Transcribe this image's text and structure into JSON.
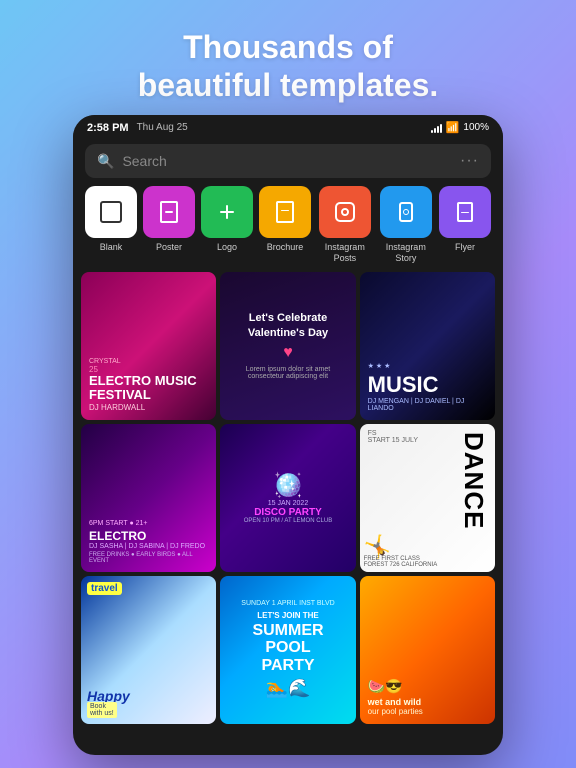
{
  "hero": {
    "line1": "Thousands of",
    "line2": "beautiful templates."
  },
  "statusBar": {
    "time": "2:58 PM",
    "date": "Thu Aug 25",
    "battery": "100%"
  },
  "search": {
    "placeholder": "Search"
  },
  "categories": [
    {
      "id": "blank",
      "label": "Blank",
      "colorClass": "cat-blank",
      "icon": "□"
    },
    {
      "id": "poster",
      "label": "Poster",
      "colorClass": "cat-poster",
      "icon": "🖼"
    },
    {
      "id": "logo",
      "label": "Logo",
      "colorClass": "cat-logo",
      "icon": "+"
    },
    {
      "id": "brochure",
      "label": "Brochure",
      "colorClass": "cat-brochure",
      "icon": "📄"
    },
    {
      "id": "instagram-posts",
      "label": "Instagram Posts",
      "colorClass": "cat-instagram-posts",
      "icon": "📷"
    },
    {
      "id": "instagram-story",
      "label": "Instagram Story",
      "colorClass": "cat-instagram-story",
      "icon": "📱"
    },
    {
      "id": "flyer",
      "label": "Flyer",
      "colorClass": "cat-flyer",
      "icon": "🗒"
    }
  ],
  "templates": [
    {
      "id": "t1",
      "title": "ELECTRO MUSIC FESTIVAL",
      "sub": "DJ HARDWALL",
      "small": "CRYSTAL"
    },
    {
      "id": "t2",
      "title": "Let's Celebrate Valentine's Day",
      "heart": "♥"
    },
    {
      "id": "t3",
      "title": "MUSIC",
      "sub": "DJ MENGAN | DJ DANIEL | DJ LIANDO"
    },
    {
      "id": "t4",
      "title": "ELECTRO",
      "sub": "DJ SASHA | DJ SABINA | DJ FREDO"
    },
    {
      "id": "t5",
      "date": "15 JAN 2022",
      "title": "DISCO PARTY",
      "sub": "OPEN 10 PM / AT LEMON CLUB"
    },
    {
      "id": "t6",
      "title": "DANCE",
      "sub": "FREE FIRST CLASS"
    },
    {
      "id": "t7",
      "title": "Happy",
      "sub": "Book with us!"
    },
    {
      "id": "t8",
      "title": "SUMMER POOL PARTY",
      "sub": "LET'S JOIN THE"
    },
    {
      "id": "t9",
      "title": "wet and wild",
      "sub": "our pool parties"
    }
  ]
}
